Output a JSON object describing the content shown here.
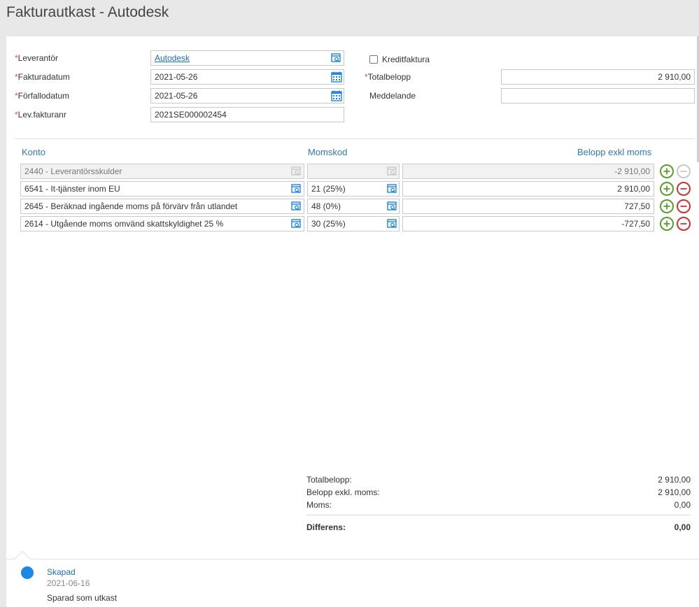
{
  "page": {
    "title": "Fakturautkast - Autodesk"
  },
  "form": {
    "supplier": {
      "label": "Leverantör",
      "value": "Autodesk"
    },
    "invoice_date": {
      "label": "Fakturadatum",
      "value": "2021-05-26"
    },
    "due_date": {
      "label": "Förfallodatum",
      "value": "2021-05-26"
    },
    "supplier_invoice_no": {
      "label": "Lev.fakturanr",
      "value": "2021SE000002454"
    },
    "credit_invoice": {
      "label": "Kreditfaktura",
      "checked": false
    },
    "total_amount": {
      "label": "Totalbelopp",
      "value": "2 910,00"
    },
    "message": {
      "label": "Meddelande",
      "value": ""
    },
    "required_mark": "*"
  },
  "table": {
    "headers": {
      "account": "Konto",
      "vat_code": "Momskod",
      "amount": "Belopp exkl moms"
    },
    "rows": [
      {
        "account": "2440 - Leverantörsskulder",
        "vat_code": "",
        "amount": "-2 910,00",
        "disabled": true
      },
      {
        "account": "6541 - It-tjänster inom EU",
        "vat_code": "21 (25%)",
        "amount": "2 910,00",
        "disabled": false
      },
      {
        "account": "2645 - Beräknad ingående moms på förvärv från utlandet",
        "vat_code": "48 (0%)",
        "amount": "727,50",
        "disabled": false
      },
      {
        "account": "2614 - Utgående moms omvänd skattskyldighet 25 %",
        "vat_code": "30 (25%)",
        "amount": "-727,50",
        "disabled": false
      }
    ]
  },
  "summary": {
    "total_label": "Totalbelopp:",
    "total_value": "2 910,00",
    "excl_vat_label": "Belopp exkl. moms:",
    "excl_vat_value": "2 910,00",
    "vat_label": "Moms:",
    "vat_value": "0,00",
    "diff_label": "Differens:",
    "diff_value": "0,00"
  },
  "history": {
    "title": "Skapad",
    "date": "2021-06-16",
    "text": "Sparad som utkast"
  },
  "colors": {
    "accent": "#2e79b9",
    "required": "#d9534f",
    "add": "#5a9e2a",
    "remove": "#d0312d",
    "status_dot": "#1b87e6"
  }
}
